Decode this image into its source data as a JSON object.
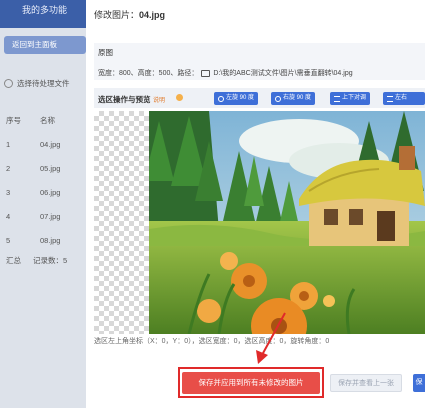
{
  "background_app": {
    "title": "我的多功能",
    "back_button": "返回到主面板",
    "select_label": "选择待处理文件",
    "table_headers": [
      "序号",
      "名称"
    ],
    "rows": [
      {
        "index": "1",
        "name": "04.jpg"
      },
      {
        "index": "2",
        "name": "05.jpg"
      },
      {
        "index": "3",
        "name": "06.jpg"
      },
      {
        "index": "4",
        "name": "07.jpg"
      },
      {
        "index": "5",
        "name": "08.jpg"
      }
    ],
    "summary_label": "汇总",
    "summary_count": "记录数：5"
  },
  "modal": {
    "title_prefix": "修改图片：",
    "title_file": "04.jpg",
    "original": {
      "label": "原图",
      "info_prefix": "宽度：800、高度：500、路径：",
      "path": "D:\\我的ABC测试文件\\图片\\需垂直翻转\\04.jpg"
    },
    "ops": {
      "label": "选区操作与预览",
      "hint": "说明",
      "buttons": {
        "rotate_left": "左旋 90 度",
        "rotate_right": "右旋 90 度",
        "flip_vertical": "上下对调",
        "flip_horizontal": "左右"
      }
    },
    "status_text": "选区左上角坐标（X：0，Y：0），选区宽度：0，选区高度：0，旋转角度：0",
    "buttons": {
      "save_apply": "保存并应用到所有未修改的图片",
      "save_prev": "保存并查看上一张",
      "edge": "保"
    }
  },
  "colors": {
    "accent_blue": "#3e6fd8",
    "save_red": "#e84e48",
    "highlight_red": "#e02a2a"
  }
}
